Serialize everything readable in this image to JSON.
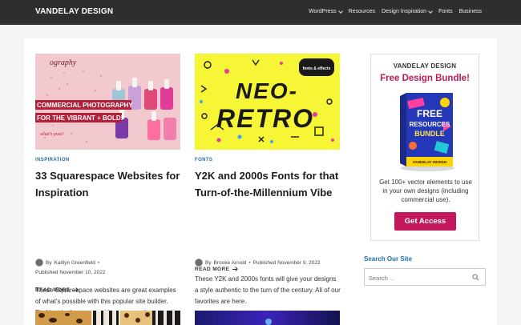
{
  "header": {
    "logo": "VANDELAY DESIGN",
    "nav": [
      {
        "label": "WordPress",
        "dropdown": true
      },
      {
        "label": "Resources",
        "dropdown": false
      },
      {
        "label": "Design Inspiration",
        "dropdown": true
      },
      {
        "label": "Fonts",
        "dropdown": false
      },
      {
        "label": "Business",
        "dropdown": false
      }
    ]
  },
  "posts": [
    {
      "thumb_text": {
        "line_a": "COMMERCIAL PHOTOGRAPHY",
        "line_b": "FOR THE VIBRANT + BOLD!",
        "line_c": "ography",
        "line_d": "what's poss!"
      },
      "category": "INSPIRATION",
      "title": "33 Squarespace Websites for Inspiration",
      "author_prefix": "By",
      "author": "Kaitlyn Greenfield",
      "published": "Published November 10, 2022",
      "excerpt": "These Squarespace websites are great examples of what's possible with this popular site builder. Find inspiration to use with your own site.",
      "read_more": "READ MORE"
    },
    {
      "thumb_text": {
        "main_a": "NEO-",
        "main_b": "RETRO",
        "sticker": "fonts & effects"
      },
      "category": "FONTS",
      "title": "Y2K and 2000s Fonts for that Turn-of-the-Millennium Vibe",
      "author_prefix": "By",
      "author": "Brooke Arnold",
      "published": "Published November 9, 2022",
      "excerpt": "These Y2K and 2000s fonts will give your designs a style authentic to the turn of the century. All of our favorites are here.",
      "read_more": "READ MORE"
    }
  ],
  "sidebar": {
    "ad": {
      "brand": "VANDELAY DESIGN",
      "title": "Free Design Bundle!",
      "box_title_a": "FREE",
      "box_title_b": "RESOURCES",
      "box_title_c": "BUNDLE",
      "box_footer": "VANDELAY DESIGN",
      "text": "Get 100+ vector elements to use in your own designs (including commercial use).",
      "button": "Get Access"
    },
    "search": {
      "heading": "Search Our Site",
      "placeholder": "Search ..."
    }
  },
  "colors": {
    "topbar": "#2e2e2e",
    "category": "#1f6fa0",
    "accent": "#c2185b",
    "neo_yellow": "#f6f536"
  }
}
